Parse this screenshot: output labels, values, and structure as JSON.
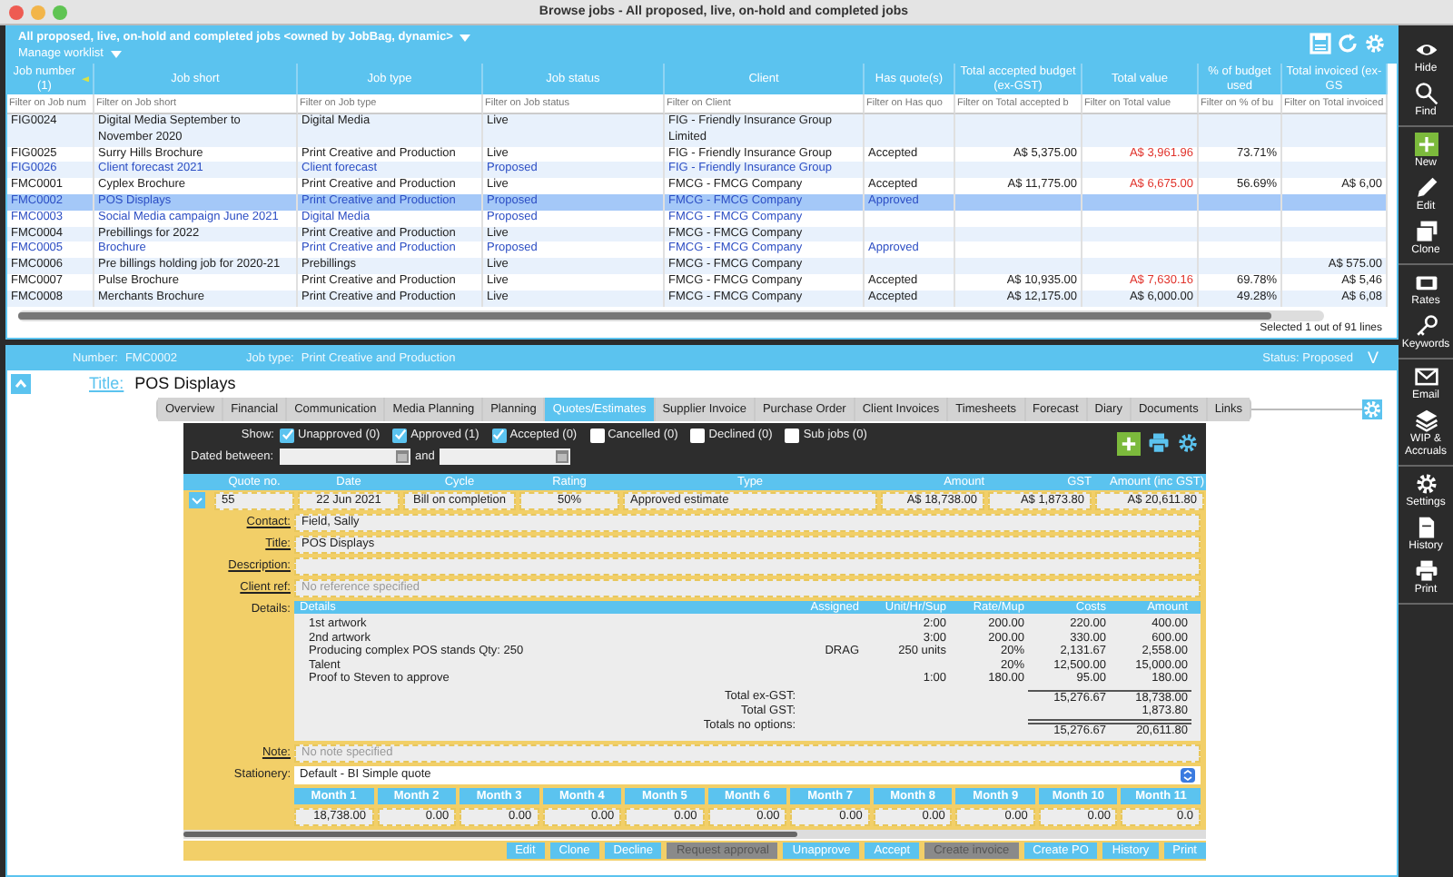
{
  "window": {
    "title": "Browse jobs - All proposed, live, on-hold and completed jobs"
  },
  "worklist": {
    "title": "All proposed, live, on-hold and completed jobs <owned by JobBag, dynamic>",
    "manage": "Manage worklist"
  },
  "table": {
    "columns": [
      {
        "label": "Job number (1)",
        "placeholder": "Filter on Job num",
        "kind": "text",
        "sorted": true
      },
      {
        "label": "Job short",
        "placeholder": "Filter on Job short",
        "kind": "text",
        "sorted": false
      },
      {
        "label": "Job type",
        "placeholder": "Filter on Job type",
        "kind": "text",
        "sorted": false
      },
      {
        "label": "Job status",
        "placeholder": "Filter on Job status",
        "kind": "text",
        "sorted": false
      },
      {
        "label": "Client",
        "placeholder": "Filter on Client",
        "kind": "text",
        "sorted": false
      },
      {
        "label": "Has quote(s)",
        "placeholder": "Filter on Has quo",
        "kind": "text",
        "sorted": false
      },
      {
        "label": "Total accepted budget (ex-GST)",
        "placeholder": "Filter on Total accepted b",
        "kind": "amount",
        "sorted": false
      },
      {
        "label": "Total value",
        "placeholder": "Filter on Total value",
        "kind": "amount",
        "sorted": false
      },
      {
        "label": "% of budget used",
        "placeholder": "Filter on % of bu",
        "kind": "amount",
        "sorted": false
      },
      {
        "label": "Total invoiced (ex-GS",
        "placeholder": "Filter on Total invoiced",
        "kind": "amount",
        "sorted": false
      }
    ],
    "rows": [
      {
        "kind": "live",
        "selected": false,
        "alert": false,
        "cells": {
          "job_number": "FIG0024",
          "job_short": "Digital Media September to November 2020",
          "job_type": "Digital Media",
          "job_status": "Live",
          "client": "FIG - Friendly Insurance Group Limited"
        }
      },
      {
        "kind": "live",
        "selected": false,
        "alert": true,
        "cells": {
          "job_number": "FIG0025",
          "job_short": "Surry Hills Brochure",
          "job_type": "Print Creative and Production",
          "job_status": "Live",
          "client": "FIG - Friendly Insurance Group",
          "has_quotes": "Accepted",
          "total_accepted_budget": "A$ 5,375.00",
          "total_value": "A$ 3,961.96",
          "budget_used": "73.71%"
        }
      },
      {
        "kind": "proposed",
        "selected": false,
        "alert": false,
        "cells": {
          "job_number": "FIG0026",
          "job_short": "Client forecast 2021",
          "job_type": "Client forecast",
          "job_status": "Proposed",
          "client": "FIG - Friendly Insurance Group"
        }
      },
      {
        "kind": "live",
        "selected": false,
        "alert": true,
        "cells": {
          "job_number": "FMC0001",
          "job_short": "Cyplex Brochure",
          "job_type": "Print Creative and Production",
          "job_status": "Live",
          "client": "FMCG - FMCG Company",
          "has_quotes": "Accepted",
          "total_accepted_budget": "A$ 11,775.00",
          "total_value": "A$ 6,675.00",
          "budget_used": "56.69%",
          "total_invoiced": "A$ 6,00"
        }
      },
      {
        "kind": "proposed",
        "selected": true,
        "alert": false,
        "cells": {
          "job_number": "FMC0002",
          "job_short": "POS Displays",
          "job_type": "Print Creative and Production",
          "job_status": "Proposed",
          "client": "FMCG - FMCG Company",
          "has_quotes": "Approved"
        }
      },
      {
        "kind": "proposed",
        "selected": false,
        "alert": false,
        "cells": {
          "job_number": "FMC0003",
          "job_short": "Social Media campaign June 2021",
          "job_type": "Digital Media",
          "job_status": "Proposed",
          "client": "FMCG - FMCG Company"
        }
      },
      {
        "kind": "live",
        "selected": false,
        "alert": false,
        "cells": {
          "job_number": "FMC0004",
          "job_short": "Prebillings for 2022",
          "job_type": "Print Creative and Production",
          "job_status": "Live",
          "client": "FMCG - FMCG Company"
        }
      },
      {
        "kind": "proposed",
        "selected": false,
        "alert": false,
        "cells": {
          "job_number": "FMC0005",
          "job_short": "Brochure",
          "job_type": "Print Creative and Production",
          "job_status": "Proposed",
          "client": "FMCG - FMCG Company",
          "has_quotes": "Approved"
        }
      },
      {
        "kind": "live",
        "selected": false,
        "alert": false,
        "cells": {
          "job_number": "FMC0006",
          "job_short": "Pre billings holding job for 2020-21",
          "job_type": "Prebillings",
          "job_status": "Live",
          "client": "FMCG - FMCG Company",
          "total_invoiced": "A$ 575.00"
        }
      },
      {
        "kind": "live",
        "selected": false,
        "alert": true,
        "cells": {
          "job_number": "FMC0007",
          "job_short": "Pulse Brochure",
          "job_type": "Print Creative and Production",
          "job_status": "Live",
          "client": "FMCG - FMCG Company",
          "has_quotes": "Accepted",
          "total_accepted_budget": "A$ 10,935.00",
          "total_value": "A$ 7,630.16",
          "budget_used": "69.78%",
          "total_invoiced": "A$ 5,46"
        }
      },
      {
        "kind": "live",
        "selected": false,
        "alert": false,
        "cells": {
          "job_number": "FMC0008",
          "job_short": "Merchants Brochure",
          "job_type": "Print Creative and Production",
          "job_status": "Live",
          "client": "FMCG - FMCG Company",
          "has_quotes": "Accepted",
          "total_accepted_budget": "A$ 12,175.00",
          "total_value": "A$ 6,000.00",
          "budget_used": "49.28%",
          "total_invoiced": "A$ 6,08"
        }
      }
    ],
    "status": "Selected 1 out of 91 lines"
  },
  "job": {
    "number_label": "Number:",
    "number": "FMC0002",
    "type_label": "Job type:",
    "type": "Print Creative and Production",
    "status": "Status: Proposed",
    "status_toggle": "V",
    "title_label": "Title:",
    "title": "POS Displays"
  },
  "tabs": [
    {
      "label": "Overview",
      "selected": false
    },
    {
      "label": "Financial",
      "selected": false
    },
    {
      "label": "Communication",
      "selected": false
    },
    {
      "label": "Media Planning",
      "selected": false
    },
    {
      "label": "Planning",
      "selected": false
    },
    {
      "label": "Quotes/Estimates",
      "selected": true
    },
    {
      "label": "Supplier Invoice",
      "selected": false
    },
    {
      "label": "Purchase Order",
      "selected": false
    },
    {
      "label": "Client Invoices",
      "selected": false
    },
    {
      "label": "Timesheets",
      "selected": false
    },
    {
      "label": "Forecast",
      "selected": false
    },
    {
      "label": "Diary",
      "selected": false
    },
    {
      "label": "Documents",
      "selected": false
    },
    {
      "label": "Links",
      "selected": false
    }
  ],
  "quotes": {
    "show_label": "Show:",
    "filters": [
      {
        "label": "Unapproved (0)",
        "checked": true
      },
      {
        "label": "Approved (1)",
        "checked": true
      },
      {
        "label": "Accepted (0)",
        "checked": true
      },
      {
        "label": "Cancelled (0)",
        "checked": false
      },
      {
        "label": "Declined (0)",
        "checked": false
      },
      {
        "label": "Sub jobs (0)",
        "checked": false
      }
    ],
    "dated_label": "Dated between:",
    "and_label": "and",
    "columns": [
      "Quote no.",
      "Date",
      "Cycle",
      "Rating",
      "Type",
      "Amount",
      "GST",
      "Amount (inc GST)"
    ],
    "row": [
      "55",
      "22 Jun 2021",
      "Bill on completion",
      "50%",
      "Approved estimate",
      "A$ 18,738.00",
      "A$ 1,873.80",
      "A$ 20,611.80"
    ],
    "fields": [
      {
        "label": "Contact:",
        "kind": "link",
        "value": "Field, Sally"
      },
      {
        "label": "Title:",
        "kind": "link",
        "value": "POS Displays"
      },
      {
        "label": "Description:",
        "kind": "link"
      },
      {
        "label": "Client ref:",
        "kind": "link",
        "placeholder": "No reference specified"
      }
    ],
    "details": {
      "label": "Details:",
      "columns": [
        "Details",
        "Assigned",
        "Unit/Hr/Sup",
        "Rate/Mup",
        "Costs",
        "Amount"
      ],
      "lines": [
        {
          "details": "1st artwork",
          "unit": "2:00",
          "rate": "200.00",
          "costs": "220.00",
          "amount": "400.00"
        },
        {
          "details": "2nd artwork",
          "unit": "3:00",
          "rate": "200.00",
          "costs": "330.00",
          "amount": "600.00"
        },
        {
          "details": "Producing complex POS stands Qty: 250",
          "assigned": "DRAG",
          "unit": "250 units",
          "rate": "20%",
          "costs": "2,131.67",
          "amount": "2,558.00"
        },
        {
          "details": "Talent",
          "rate": "20%",
          "costs": "12,500.00",
          "amount": "15,000.00"
        },
        {
          "details": "Proof to Steven to approve",
          "unit": "1:00",
          "rate": "180.00",
          "costs": "95.00",
          "amount": "180.00"
        }
      ],
      "totals": [
        {
          "label": "Total ex-GST:",
          "costs": "15,276.67",
          "amount": "18,738.00"
        },
        {
          "label": "Total GST:",
          "amount": "1,873.80"
        },
        {
          "label": "Totals no options:",
          "costs": "15,276.67",
          "amount": "20,611.80"
        }
      ]
    },
    "note": {
      "label": "Note:",
      "placeholder": "No note specified"
    },
    "stationery": {
      "label": "Stationery:",
      "value": "Default - BI Simple quote"
    },
    "months": {
      "labels": [
        "Month 1",
        "Month 2",
        "Month 3",
        "Month 4",
        "Month 5",
        "Month 6",
        "Month 7",
        "Month 8",
        "Month 9",
        "Month 10",
        "Month 11"
      ],
      "values": [
        "18,738.00",
        "0.00",
        "0.00",
        "0.00",
        "0.00",
        "0.00",
        "0.00",
        "0.00",
        "0.00",
        "0.00",
        "0.0"
      ]
    },
    "buttons": [
      {
        "label": "Edit",
        "disabled": false
      },
      {
        "label": "Clone",
        "disabled": false
      },
      {
        "label": "Decline",
        "disabled": false
      },
      {
        "label": "Request approval",
        "disabled": true
      },
      {
        "label": "Unapprove",
        "disabled": false
      },
      {
        "label": "Accept",
        "disabled": false
      },
      {
        "label": "Create invoice",
        "disabled": true
      },
      {
        "label": "Create PO",
        "disabled": false
      },
      {
        "label": "History",
        "disabled": false
      },
      {
        "label": "Print",
        "disabled": false
      }
    ]
  },
  "sidebar": {
    "groups": [
      [
        {
          "label": "Hide",
          "kind": "hide"
        },
        {
          "label": "Find",
          "kind": "find"
        }
      ],
      [
        {
          "label": "New",
          "kind": "new"
        },
        {
          "label": "Edit",
          "kind": "edit"
        },
        {
          "label": "Clone",
          "kind": "clone"
        }
      ],
      [
        {
          "label": "Rates",
          "kind": "rates"
        },
        {
          "label": "Keywords",
          "kind": "keywords"
        }
      ],
      [
        {
          "label": "Email",
          "kind": "email"
        },
        {
          "label": "WIP & Accruals",
          "kind": "wip"
        }
      ],
      [
        {
          "label": "Settings",
          "kind": "settings"
        },
        {
          "label": "History",
          "kind": "history"
        },
        {
          "label": "Print",
          "kind": "print"
        }
      ]
    ]
  }
}
